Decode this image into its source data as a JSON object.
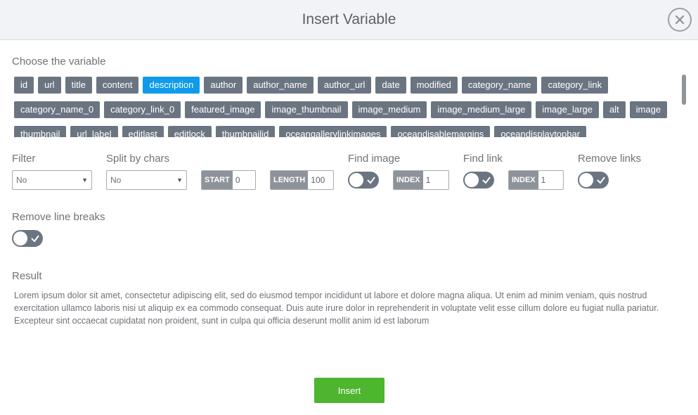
{
  "header": {
    "title": "Insert Variable"
  },
  "variables": {
    "label": "Choose the variable",
    "items": [
      "id",
      "url",
      "title",
      "content",
      "description",
      "author",
      "author_name",
      "author_url",
      "date",
      "modified",
      "category_name",
      "category_link",
      "category_name_0",
      "category_link_0",
      "featured_image",
      "image_thumbnail",
      "image_medium",
      "image_medium_large",
      "image_large",
      "alt",
      "image",
      "thumbnail",
      "url_label",
      "editlast",
      "editlock",
      "thumbnailid",
      "oceangallerylinkimages",
      "oceandisablemargins",
      "oceandisplaytopbar"
    ],
    "selected": "description"
  },
  "options": {
    "filter": {
      "label": "Filter",
      "value": "No"
    },
    "split": {
      "label": "Split by chars",
      "value": "No"
    },
    "start": {
      "tag": "START",
      "value": "0"
    },
    "length": {
      "tag": "LENGTH",
      "value": "100"
    },
    "find_image": {
      "label": "Find image",
      "index_tag": "INDEX",
      "index_value": "1"
    },
    "find_link": {
      "label": "Find link",
      "index_tag": "INDEX",
      "index_value": "1"
    },
    "remove_links": {
      "label": "Remove links"
    },
    "remove_line_breaks": {
      "label": "Remove line breaks"
    }
  },
  "result": {
    "label": "Result",
    "text": "Lorem ipsum dolor sit amet, consectetur adipiscing elit, sed do eiusmod tempor incididunt ut labore et dolore magna aliqua. Ut enim ad minim veniam, quis nostrud exercitation ullamco laboris nisi ut aliquip ex ea commodo consequat. Duis aute irure dolor in reprehenderit in voluptate velit esse cillum dolore eu fugiat nulla pariatur. Excepteur sint occaecat cupidatat non proident, sunt in culpa qui officia deserunt mollit anim id est laborum"
  },
  "actions": {
    "insert_label": "Insert"
  },
  "colors": {
    "chip": "#6b7582",
    "chip_selected": "#0d9bea",
    "insert": "#4db52e"
  },
  "icons": {
    "close": "close-icon",
    "toggle_check": "check-icon",
    "select_arrow": "chevron-down-icon"
  }
}
